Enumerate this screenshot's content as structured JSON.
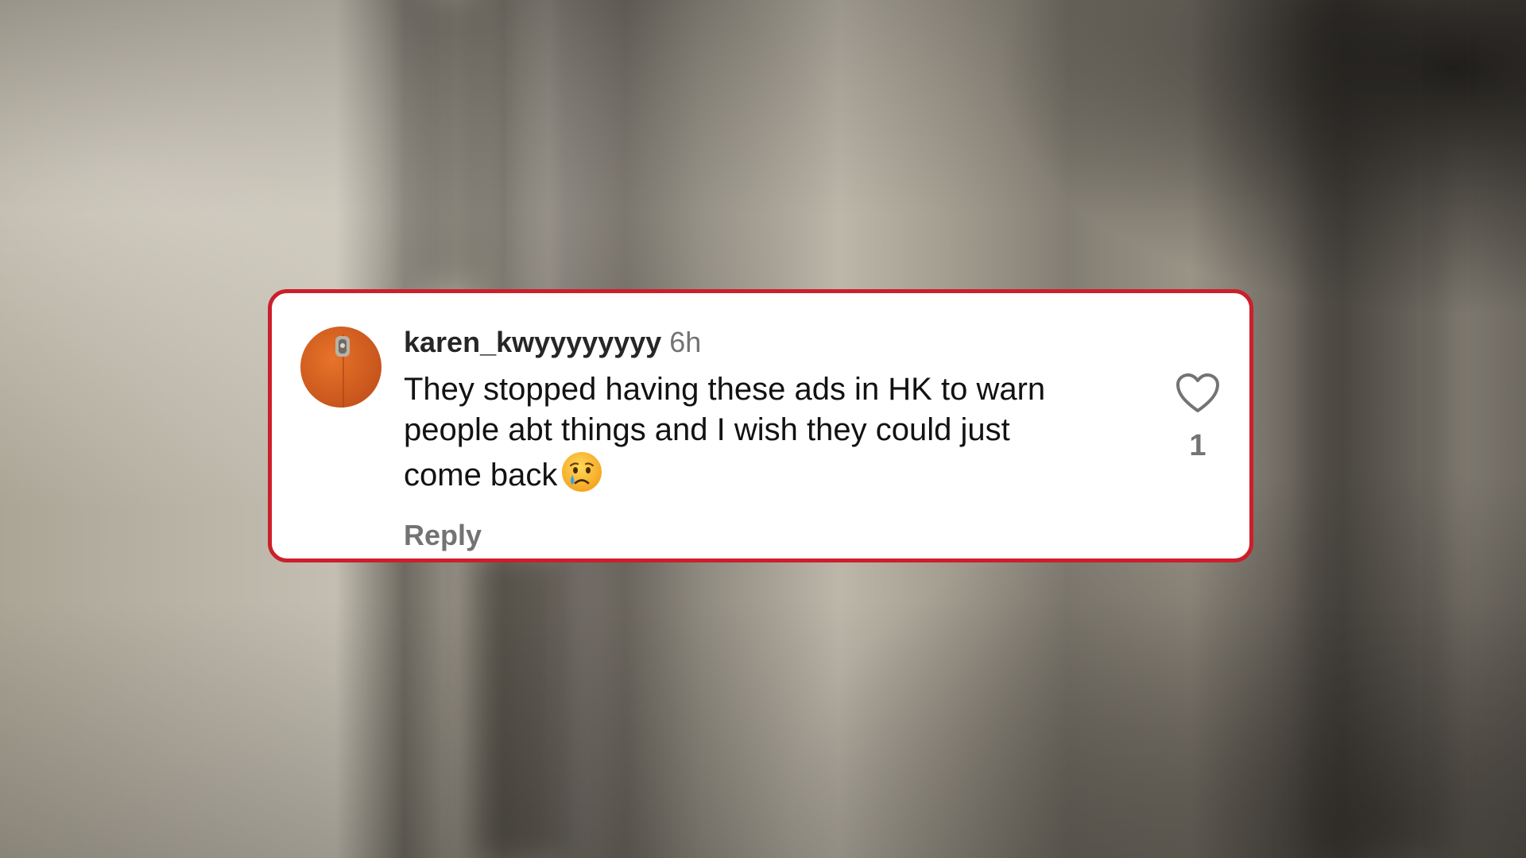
{
  "comment": {
    "username": "karen_kwyyyyyyyy",
    "timestamp": "6h",
    "text": "They stopped having these ads in HK to warn people abt things and I wish they could just come back",
    "emoji": "crying-face-icon",
    "reply_label": "Reply",
    "like_count": "1"
  },
  "colors": {
    "card_border": "#cc1f2b",
    "avatar": "#d9621f",
    "muted_text": "#737373"
  }
}
